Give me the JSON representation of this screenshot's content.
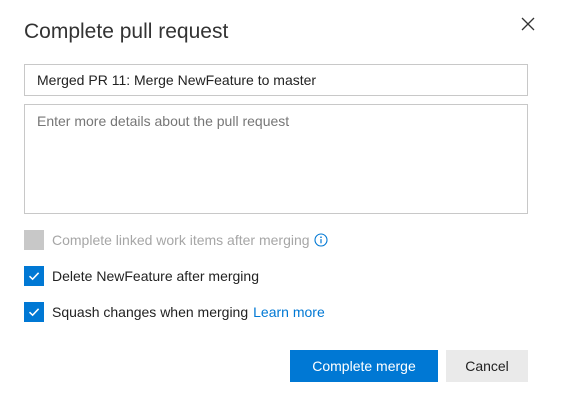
{
  "dialog": {
    "title": "Complete pull request",
    "close_icon": "close-icon"
  },
  "form": {
    "title_value": "Merged PR 11: Merge NewFeature to master",
    "details_placeholder": "Enter more details about the pull request",
    "details_value": ""
  },
  "options": {
    "complete_work_items": {
      "label": "Complete linked work items after merging",
      "checked": false,
      "disabled": true,
      "icon": "info-icon"
    },
    "delete_branch": {
      "label": "Delete NewFeature after merging",
      "checked": true
    },
    "squash": {
      "label": "Squash changes when merging",
      "checked": true,
      "link_label": "Learn more"
    }
  },
  "actions": {
    "primary_label": "Complete merge",
    "cancel_label": "Cancel"
  },
  "colors": {
    "accent": "#0078d4",
    "disabled": "#c8c8c8",
    "button_secondary": "#eaeaea"
  }
}
